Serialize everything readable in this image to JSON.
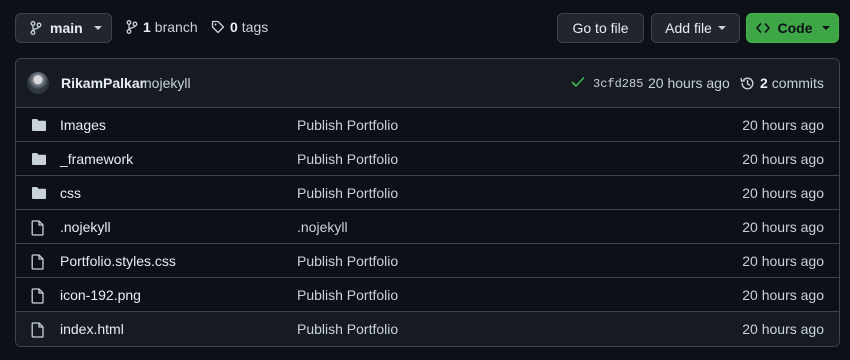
{
  "toolbar": {
    "branch_label": "main",
    "branch_count": "1",
    "branch_text": "branch",
    "tag_count": "0",
    "tag_text": "tags",
    "goto_file_label": "Go to file",
    "add_file_label": "Add file",
    "code_label": "Code"
  },
  "commit": {
    "author": "RikamPalkar",
    "message": ".nojekyll",
    "sha": "3cfd285",
    "time": "20 hours ago",
    "commits_count": "2",
    "commits_text": "commits"
  },
  "files": [
    {
      "type": "folder",
      "name": "Images",
      "message": "Publish Portfolio",
      "time": "20 hours ago"
    },
    {
      "type": "folder",
      "name": "_framework",
      "message": "Publish Portfolio",
      "time": "20 hours ago"
    },
    {
      "type": "folder",
      "name": "css",
      "message": "Publish Portfolio",
      "time": "20 hours ago"
    },
    {
      "type": "file",
      "name": ".nojekyll",
      "message": ".nojekyll",
      "time": "20 hours ago"
    },
    {
      "type": "file",
      "name": "Portfolio.styles.css",
      "message": "Publish Portfolio",
      "time": "20 hours ago"
    },
    {
      "type": "file",
      "name": "icon-192.png",
      "message": "Publish Portfolio",
      "time": "20 hours ago"
    },
    {
      "type": "file",
      "name": "index.html",
      "message": "Publish Portfolio",
      "time": "20 hours ago"
    }
  ],
  "colors": {
    "background": "#0d1117",
    "border": "#3d444d",
    "code_button": "#3fa648",
    "check": "#3fb950",
    "icon": "#c9d1d9"
  }
}
